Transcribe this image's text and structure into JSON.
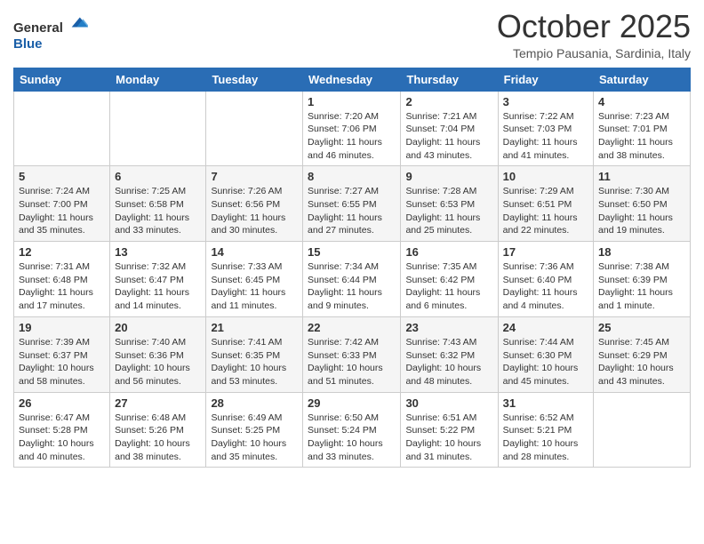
{
  "logo": {
    "text_general": "General",
    "text_blue": "Blue"
  },
  "title": "October 2025",
  "subtitle": "Tempio Pausania, Sardinia, Italy",
  "days_of_week": [
    "Sunday",
    "Monday",
    "Tuesday",
    "Wednesday",
    "Thursday",
    "Friday",
    "Saturday"
  ],
  "weeks": [
    [
      {
        "day": "",
        "info": ""
      },
      {
        "day": "",
        "info": ""
      },
      {
        "day": "",
        "info": ""
      },
      {
        "day": "1",
        "info": "Sunrise: 7:20 AM\nSunset: 7:06 PM\nDaylight: 11 hours and 46 minutes."
      },
      {
        "day": "2",
        "info": "Sunrise: 7:21 AM\nSunset: 7:04 PM\nDaylight: 11 hours and 43 minutes."
      },
      {
        "day": "3",
        "info": "Sunrise: 7:22 AM\nSunset: 7:03 PM\nDaylight: 11 hours and 41 minutes."
      },
      {
        "day": "4",
        "info": "Sunrise: 7:23 AM\nSunset: 7:01 PM\nDaylight: 11 hours and 38 minutes."
      }
    ],
    [
      {
        "day": "5",
        "info": "Sunrise: 7:24 AM\nSunset: 7:00 PM\nDaylight: 11 hours and 35 minutes."
      },
      {
        "day": "6",
        "info": "Sunrise: 7:25 AM\nSunset: 6:58 PM\nDaylight: 11 hours and 33 minutes."
      },
      {
        "day": "7",
        "info": "Sunrise: 7:26 AM\nSunset: 6:56 PM\nDaylight: 11 hours and 30 minutes."
      },
      {
        "day": "8",
        "info": "Sunrise: 7:27 AM\nSunset: 6:55 PM\nDaylight: 11 hours and 27 minutes."
      },
      {
        "day": "9",
        "info": "Sunrise: 7:28 AM\nSunset: 6:53 PM\nDaylight: 11 hours and 25 minutes."
      },
      {
        "day": "10",
        "info": "Sunrise: 7:29 AM\nSunset: 6:51 PM\nDaylight: 11 hours and 22 minutes."
      },
      {
        "day": "11",
        "info": "Sunrise: 7:30 AM\nSunset: 6:50 PM\nDaylight: 11 hours and 19 minutes."
      }
    ],
    [
      {
        "day": "12",
        "info": "Sunrise: 7:31 AM\nSunset: 6:48 PM\nDaylight: 11 hours and 17 minutes."
      },
      {
        "day": "13",
        "info": "Sunrise: 7:32 AM\nSunset: 6:47 PM\nDaylight: 11 hours and 14 minutes."
      },
      {
        "day": "14",
        "info": "Sunrise: 7:33 AM\nSunset: 6:45 PM\nDaylight: 11 hours and 11 minutes."
      },
      {
        "day": "15",
        "info": "Sunrise: 7:34 AM\nSunset: 6:44 PM\nDaylight: 11 hours and 9 minutes."
      },
      {
        "day": "16",
        "info": "Sunrise: 7:35 AM\nSunset: 6:42 PM\nDaylight: 11 hours and 6 minutes."
      },
      {
        "day": "17",
        "info": "Sunrise: 7:36 AM\nSunset: 6:40 PM\nDaylight: 11 hours and 4 minutes."
      },
      {
        "day": "18",
        "info": "Sunrise: 7:38 AM\nSunset: 6:39 PM\nDaylight: 11 hours and 1 minute."
      }
    ],
    [
      {
        "day": "19",
        "info": "Sunrise: 7:39 AM\nSunset: 6:37 PM\nDaylight: 10 hours and 58 minutes."
      },
      {
        "day": "20",
        "info": "Sunrise: 7:40 AM\nSunset: 6:36 PM\nDaylight: 10 hours and 56 minutes."
      },
      {
        "day": "21",
        "info": "Sunrise: 7:41 AM\nSunset: 6:35 PM\nDaylight: 10 hours and 53 minutes."
      },
      {
        "day": "22",
        "info": "Sunrise: 7:42 AM\nSunset: 6:33 PM\nDaylight: 10 hours and 51 minutes."
      },
      {
        "day": "23",
        "info": "Sunrise: 7:43 AM\nSunset: 6:32 PM\nDaylight: 10 hours and 48 minutes."
      },
      {
        "day": "24",
        "info": "Sunrise: 7:44 AM\nSunset: 6:30 PM\nDaylight: 10 hours and 45 minutes."
      },
      {
        "day": "25",
        "info": "Sunrise: 7:45 AM\nSunset: 6:29 PM\nDaylight: 10 hours and 43 minutes."
      }
    ],
    [
      {
        "day": "26",
        "info": "Sunrise: 6:47 AM\nSunset: 5:28 PM\nDaylight: 10 hours and 40 minutes."
      },
      {
        "day": "27",
        "info": "Sunrise: 6:48 AM\nSunset: 5:26 PM\nDaylight: 10 hours and 38 minutes."
      },
      {
        "day": "28",
        "info": "Sunrise: 6:49 AM\nSunset: 5:25 PM\nDaylight: 10 hours and 35 minutes."
      },
      {
        "day": "29",
        "info": "Sunrise: 6:50 AM\nSunset: 5:24 PM\nDaylight: 10 hours and 33 minutes."
      },
      {
        "day": "30",
        "info": "Sunrise: 6:51 AM\nSunset: 5:22 PM\nDaylight: 10 hours and 31 minutes."
      },
      {
        "day": "31",
        "info": "Sunrise: 6:52 AM\nSunset: 5:21 PM\nDaylight: 10 hours and 28 minutes."
      },
      {
        "day": "",
        "info": ""
      }
    ]
  ]
}
